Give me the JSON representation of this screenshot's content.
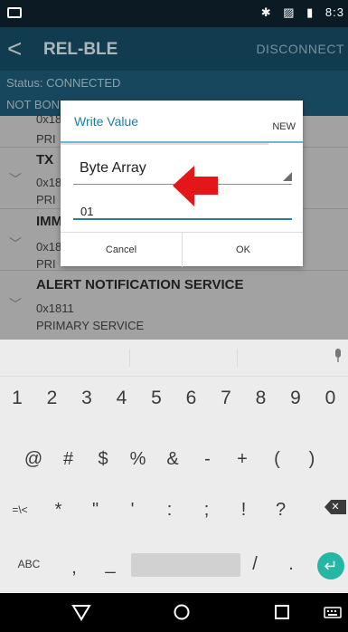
{
  "status_bar": {
    "time": "8:3",
    "icons": [
      "image-icon",
      "bluetooth-icon",
      "no-sim-icon",
      "battery-icon"
    ]
  },
  "app_bar": {
    "back": "<",
    "title": "REL-BLE",
    "action": "DISCONNECT"
  },
  "status": {
    "connection": "Status: CONNECTED",
    "bond": "NOT BON"
  },
  "services": [
    {
      "name": "",
      "uuid": "0x18",
      "type": "PRI"
    },
    {
      "name": "TX",
      "uuid": "0x18",
      "type": "PRI"
    },
    {
      "name": "IMM",
      "uuid": "0x18",
      "type": "PRI"
    },
    {
      "name": "ALERT NOTIFICATION SERVICE",
      "uuid": "0x1811",
      "type": "PRIMARY SERVICE"
    }
  ],
  "dialog": {
    "title": "Write Value",
    "tab_new": "NEW",
    "spinner_value": "Byte Array",
    "input_value": "01",
    "cancel": "Cancel",
    "ok": "OK"
  },
  "keyboard": {
    "row1": [
      "1",
      "2",
      "3",
      "4",
      "5",
      "6",
      "7",
      "8",
      "9",
      "0"
    ],
    "row2": [
      "@",
      "#",
      "$",
      "%",
      "&",
      "-",
      "+",
      "(",
      ")"
    ],
    "row3": [
      "=\\<",
      "*",
      "\"",
      "'",
      ":",
      ";",
      "!",
      "?"
    ],
    "row4": [
      "ABC",
      ",",
      "_",
      "/",
      "."
    ]
  },
  "nav": [
    "back-icon",
    "home-icon",
    "recents-icon",
    "keyboard-switch-icon"
  ],
  "colors": {
    "appbar": "#17506a",
    "accent": "#2a7ea1",
    "arrow": "#e3161a",
    "enter": "#26b6a6"
  }
}
